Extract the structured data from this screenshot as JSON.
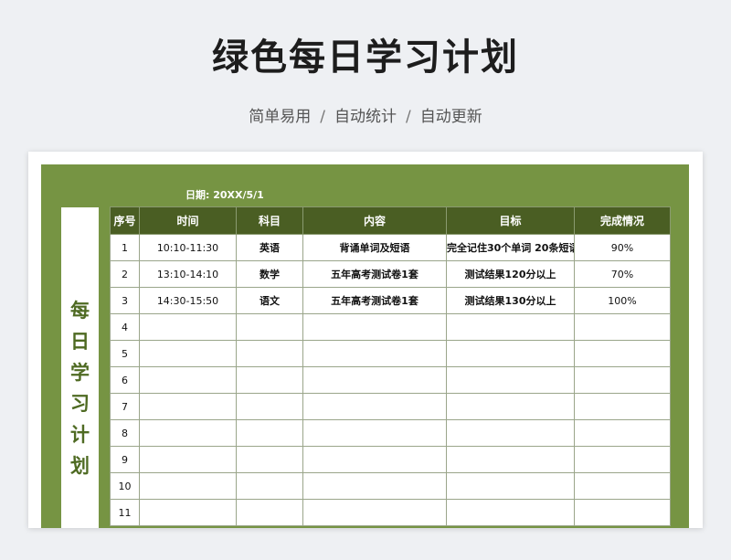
{
  "title": "绿色每日学习计划",
  "subtitle": [
    "简单易用",
    "自动统计",
    "自动更新"
  ],
  "subtitle_separator": "/",
  "sheet": {
    "date_text": "日期:  20XX/5/1",
    "side_label": [
      "每",
      "日",
      "学",
      "习",
      "计",
      "划"
    ],
    "columns": [
      "序号",
      "时间",
      "科目",
      "内容",
      "目标",
      "完成情况"
    ],
    "rows": [
      {
        "no": "1",
        "time": "10:10-11:30",
        "subject": "英语",
        "content": "背诵单词及短语",
        "goal": "完全记住30个单词 20条短语",
        "completion": "90%"
      },
      {
        "no": "2",
        "time": "13:10-14:10",
        "subject": "数学",
        "content": "五年高考测试卷1套",
        "goal": "测试结果120分以上",
        "completion": "70%"
      },
      {
        "no": "3",
        "time": "14:30-15:50",
        "subject": "语文",
        "content": "五年高考测试卷1套",
        "goal": "测试结果130分以上",
        "completion": "100%"
      },
      {
        "no": "4",
        "time": "",
        "subject": "",
        "content": "",
        "goal": "",
        "completion": ""
      },
      {
        "no": "5",
        "time": "",
        "subject": "",
        "content": "",
        "goal": "",
        "completion": ""
      },
      {
        "no": "6",
        "time": "",
        "subject": "",
        "content": "",
        "goal": "",
        "completion": ""
      },
      {
        "no": "7",
        "time": "",
        "subject": "",
        "content": "",
        "goal": "",
        "completion": ""
      },
      {
        "no": "8",
        "time": "",
        "subject": "",
        "content": "",
        "goal": "",
        "completion": ""
      },
      {
        "no": "9",
        "time": "",
        "subject": "",
        "content": "",
        "goal": "",
        "completion": ""
      },
      {
        "no": "10",
        "time": "",
        "subject": "",
        "content": "",
        "goal": "",
        "completion": ""
      },
      {
        "no": "11",
        "time": "",
        "subject": "",
        "content": "",
        "goal": "",
        "completion": ""
      }
    ]
  },
  "colors": {
    "panel_green": "#769443",
    "header_green": "#4a5e23",
    "side_text": "#4e6a22",
    "background": "#eef0f3"
  }
}
